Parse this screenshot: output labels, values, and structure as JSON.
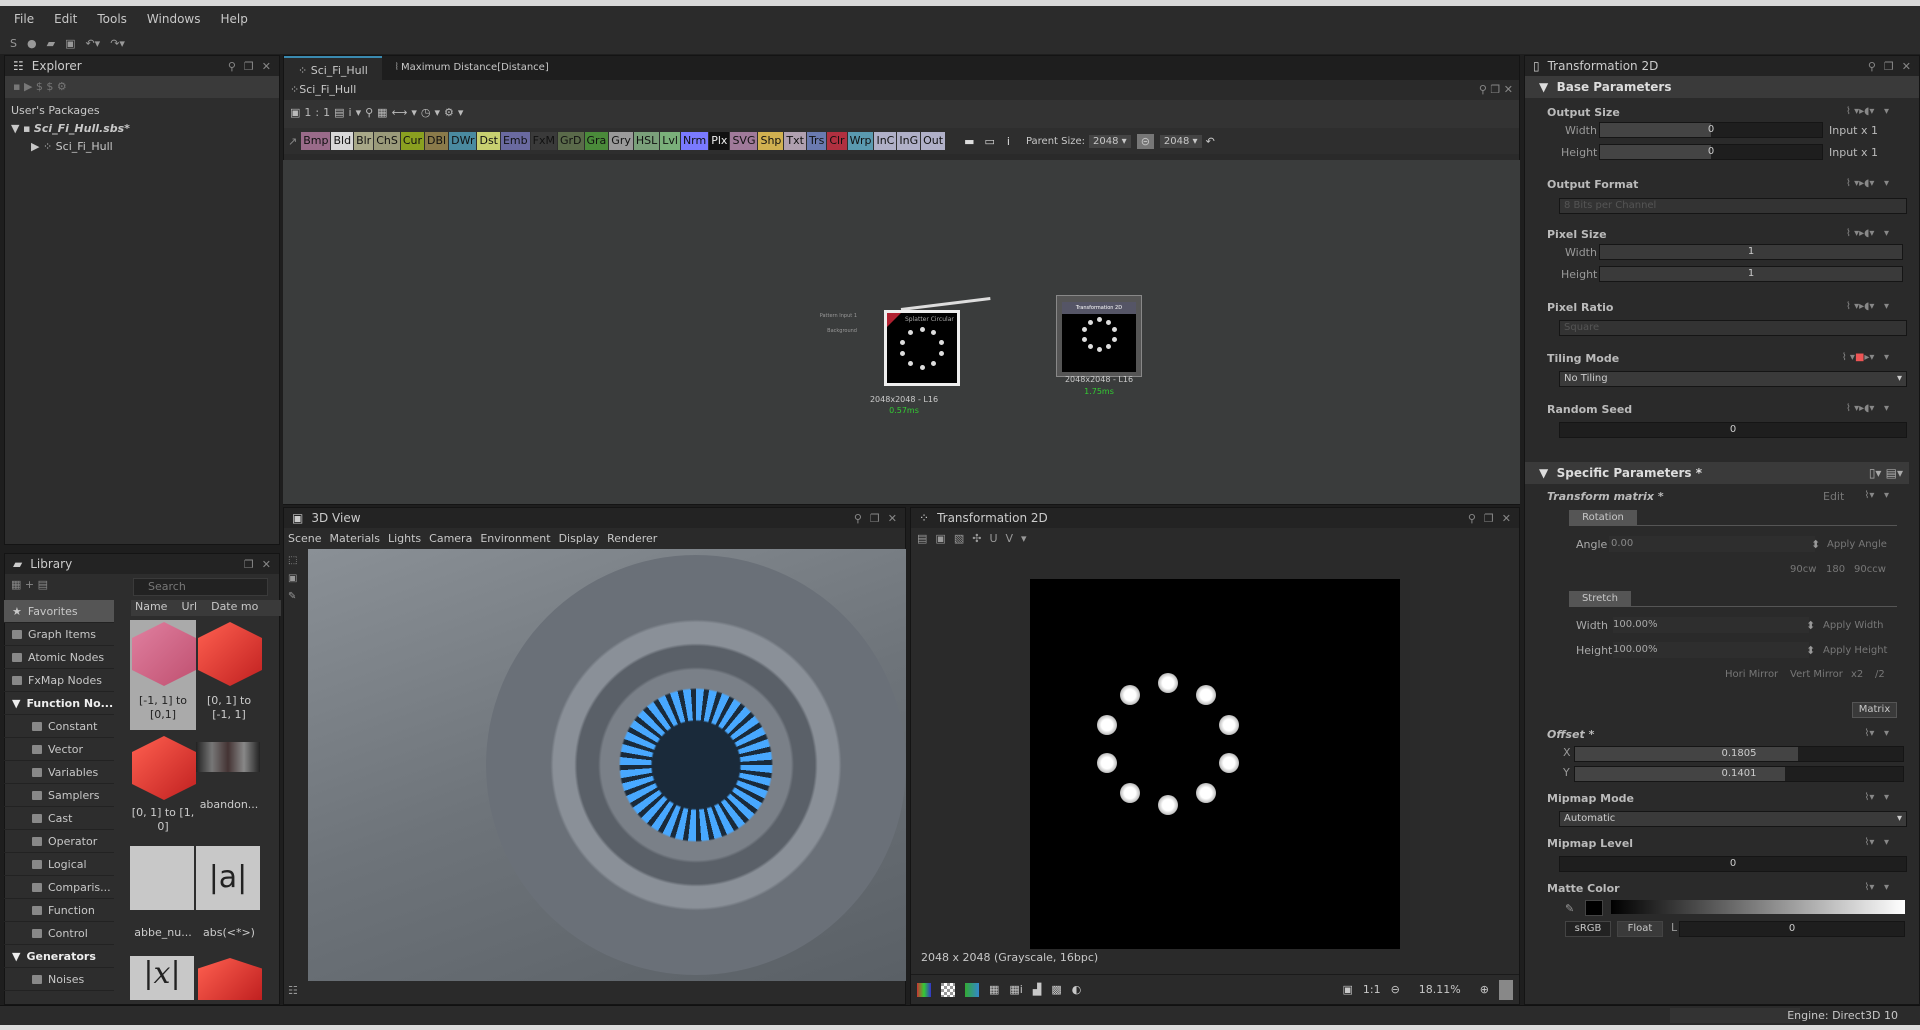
{
  "menu": [
    "File",
    "Edit",
    "Tools",
    "Windows",
    "Help"
  ],
  "explorer": {
    "title": "Explorer",
    "section": "User's Packages",
    "package": "Sci_Fi_Hull.sbs*",
    "graph": "Sci_Fi_Hull"
  },
  "library": {
    "title": "Library",
    "search_placeholder": "Search",
    "columns": [
      "Name",
      "Url",
      "Date mo"
    ],
    "categories": [
      {
        "label": "Favorites"
      },
      {
        "label": "Graph Items"
      },
      {
        "label": "Atomic Nodes"
      },
      {
        "label": "FxMap Nodes"
      },
      {
        "label": "Function No..."
      },
      {
        "label": "Constant"
      },
      {
        "label": "Vector"
      },
      {
        "label": "Variables"
      },
      {
        "label": "Samplers"
      },
      {
        "label": "Cast"
      },
      {
        "label": "Operator"
      },
      {
        "label": "Logical"
      },
      {
        "label": "Comparis..."
      },
      {
        "label": "Function"
      },
      {
        "label": "Control"
      },
      {
        "label": "Generators"
      },
      {
        "label": "Noises"
      }
    ],
    "items": [
      "[-1, 1] to [0,1]",
      "[0, 1] to [-1, 1]",
      "[0, 1] to [1, 0]",
      "abandon...",
      "abbe_nu...",
      "abs(<*>)"
    ]
  },
  "graph": {
    "tabs": [
      "Sci_Fi_Hull",
      "Maximum Distance[Distance]"
    ],
    "breadcrumb": "Sci_Fi_Hull",
    "node_buttons": [
      {
        "t": "Bmp",
        "c": "#9a6b8a"
      },
      {
        "t": "Bld",
        "c": "#d8d8d8"
      },
      {
        "t": "Blr",
        "c": "#a8a888"
      },
      {
        "t": "ChS",
        "c": "#9a9a7a"
      },
      {
        "t": "Cur",
        "c": "#8aa020"
      },
      {
        "t": "DBl",
        "c": "#8a7a4a"
      },
      {
        "t": "DWr",
        "c": "#4a8aa0"
      },
      {
        "t": "Dst",
        "c": "#c8d070"
      },
      {
        "t": "Emb",
        "c": "#6a6aa0"
      },
      {
        "t": "FxM",
        "c": "#3a3a3a"
      },
      {
        "t": "GrD",
        "c": "#5a6a4a"
      },
      {
        "t": "Gra",
        "c": "#4a8a3a"
      },
      {
        "t": "Gry",
        "c": "#9a9a9a"
      },
      {
        "t": "HSL",
        "c": "#7aa07a"
      },
      {
        "t": "Lvl",
        "c": "#7ab07a"
      },
      {
        "t": "Nrm",
        "c": "#7a7aff"
      },
      {
        "t": "Plx",
        "c": "#111111"
      },
      {
        "t": "SVG",
        "c": "#a07a9a"
      },
      {
        "t": "Shp",
        "c": "#d0b050"
      },
      {
        "t": "Txt",
        "c": "#b0a0b0"
      },
      {
        "t": "Trs",
        "c": "#6a7ab0"
      },
      {
        "t": "Clr",
        "c": "#b03040"
      },
      {
        "t": "Wrp",
        "c": "#5a9ab0"
      },
      {
        "t": "InC",
        "c": "#b0b0c8"
      },
      {
        "t": "InG",
        "c": "#b0b0c8"
      },
      {
        "t": "Out",
        "c": "#b0b0c8"
      }
    ],
    "parent_size_label": "Parent Size:",
    "parent_w": "2048",
    "parent_h": "2048",
    "node1": {
      "inputs": [
        "Pattern Input 1",
        "Background"
      ],
      "output": "Splatter Circular",
      "info": "2048x2048 - L16",
      "time": "0.57ms"
    },
    "node2": {
      "title": "Transformation 2D",
      "info": "2048x2048 - L16",
      "time": "1.75ms"
    }
  },
  "view3d": {
    "title": "3D View",
    "menu": [
      "Scene",
      "Materials",
      "Lights",
      "Camera",
      "Environment",
      "Display",
      "Renderer"
    ]
  },
  "view2d": {
    "title": "Transformation 2D",
    "info": "2048 x 2048 (Grayscale, 16bpc)",
    "zoom": "18.11%",
    "one_to_one": "1:1"
  },
  "props": {
    "title": "Transformation 2D",
    "base": "Base Parameters",
    "output_size": {
      "label": "Output Size",
      "width_label": "Width",
      "width": "0",
      "width_suffix": "Input x 1",
      "height_label": "Height",
      "height": "0",
      "height_suffix": "Input x 1"
    },
    "output_format": {
      "label": "Output Format",
      "value": "8 Bits per Channel"
    },
    "pixel_size": {
      "label": "Pixel Size",
      "width_label": "Width",
      "width": "1",
      "height_label": "Height",
      "height": "1"
    },
    "pixel_ratio": {
      "label": "Pixel Ratio",
      "value": "Square"
    },
    "tiling": {
      "label": "Tiling Mode",
      "value": "No Tiling"
    },
    "seed": {
      "label": "Random Seed",
      "value": "0"
    },
    "specific": "Specific Parameters *",
    "matrix": {
      "label": "Transform matrix *",
      "edit": "Edit",
      "rotation": "Rotation",
      "angle_label": "Angle",
      "angle": "0.00",
      "apply_angle": "Apply Angle",
      "rot_btns": [
        "90cw",
        "180",
        "90ccw"
      ],
      "stretch": "Stretch",
      "width_label": "Width",
      "width": "100.00%",
      "apply_width": "Apply Width",
      "height_label": "Height",
      "height": "100.00%",
      "apply_height": "Apply Height",
      "mirror_btns": [
        "Hori Mirror",
        "Vert Mirror",
        "x2",
        "/2"
      ],
      "matrix_btn": "Matrix"
    },
    "offset": {
      "label": "Offset *",
      "x_label": "X",
      "x": "0.1805",
      "y_label": "Y",
      "y": "0.1401"
    },
    "mipmap_mode": {
      "label": "Mipmap Mode",
      "value": "Automatic"
    },
    "mipmap_level": {
      "label": "Mipmap Level",
      "value": "0"
    },
    "matte": {
      "label": "Matte Color",
      "srgb": "sRGB",
      "float": "Float",
      "l_label": "L",
      "value": "0"
    }
  },
  "status": {
    "engine": "Engine: Direct3D 10"
  }
}
